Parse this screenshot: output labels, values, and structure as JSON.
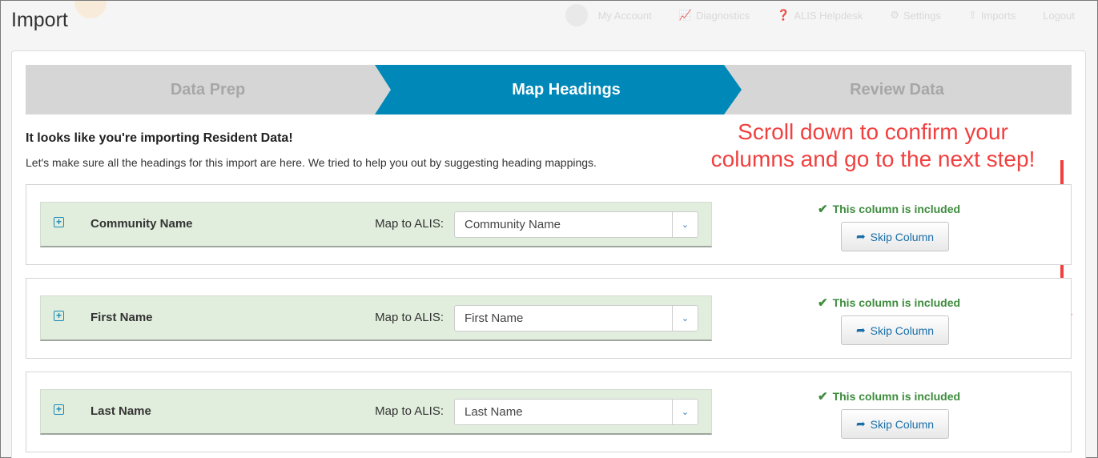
{
  "nav": {
    "my_account": "My Account",
    "diagnostics": "Diagnostics",
    "helpdesk": "ALIS Helpdesk",
    "settings": "Settings",
    "imports": "Imports",
    "logout": "Logout"
  },
  "page": {
    "title": "Import"
  },
  "steps": [
    {
      "label": "Data Prep",
      "state": "inactive"
    },
    {
      "label": "Map Headings",
      "state": "active"
    },
    {
      "label": "Review Data",
      "state": "inactive"
    }
  ],
  "intro": {
    "title": "It looks like you're importing Resident Data!",
    "text": "Let's make sure all the headings for this import are here. We tried to help you out by suggesting heading mappings."
  },
  "annotation": {
    "line1": "Scroll down to confirm your",
    "line2": "columns and go to the next step!",
    "color": "#f0403f"
  },
  "map_label": "Map to ALIS:",
  "status_text": "This column is included",
  "skip_label": "Skip Column",
  "rows": [
    {
      "column": "Community Name",
      "mapped": "Community Name"
    },
    {
      "column": "First Name",
      "mapped": "First Name"
    },
    {
      "column": "Last Name",
      "mapped": "Last Name"
    }
  ],
  "colors": {
    "accent": "#0088b8",
    "row_bg": "#e1eedd",
    "success": "#3d8b3d",
    "link": "#1a6ea8"
  }
}
